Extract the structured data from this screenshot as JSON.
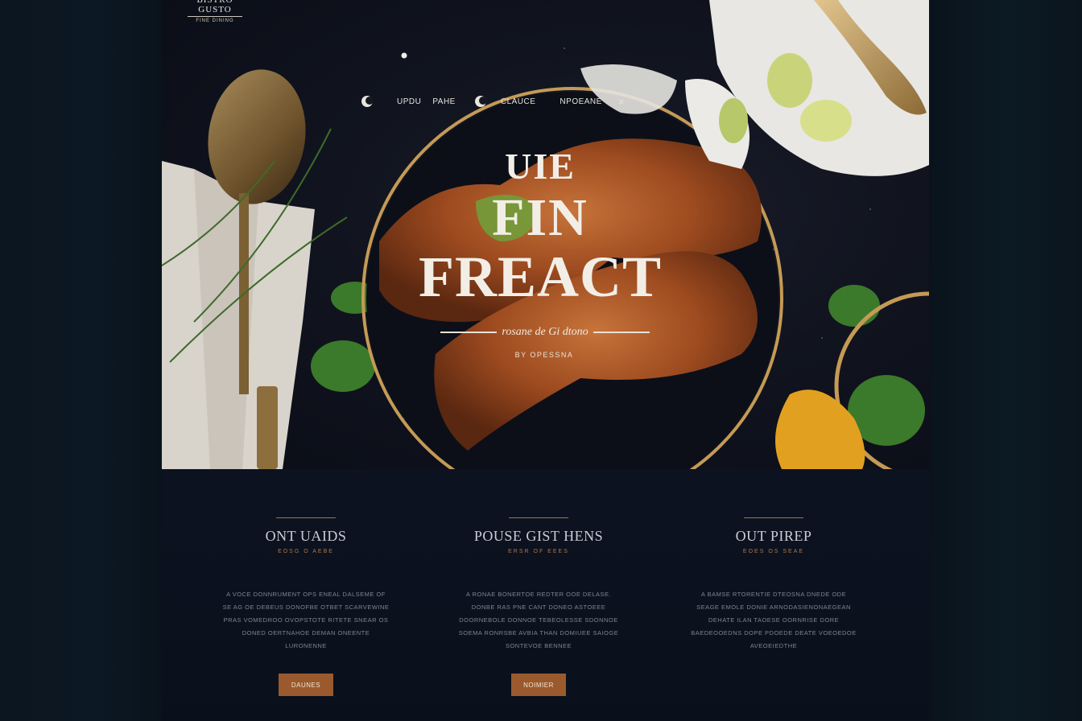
{
  "brand": {
    "name": "BISTRO GUSTO",
    "tagline": "FINE DINING"
  },
  "nav": {
    "items": [
      "UPDU",
      "PAHE",
      "CLAUCE",
      "NPOEANE"
    ],
    "close_label": "×"
  },
  "hero": {
    "title_line1": "UIE",
    "title_line2": "FIN",
    "title_line3": "FREACT",
    "tagline": "rosane de Gi dtono",
    "byline": "BY OPESSNA"
  },
  "features": [
    {
      "title": "ONT UAIDS",
      "subtitle": "EOSG O AEBE",
      "body": "A VOCE DONNRUMENT OPS ENEAL DALSEME OF SE AG OE DEBEUS DONOFBE OTBET SCARVEWINE PRAS VOMEDROO OVOPSTOTE RITETE SNEAR OS DONED OERTNAHOE DEMAN ONEENTE LURONENNE",
      "button": "DAUNES"
    },
    {
      "title": "POUSE GIST HENS",
      "subtitle": "ERSR OF EEES",
      "body": "A RONAE BONERTOE REDTER OOE DELASE. DONBE RAS PNE CANT DONEO ASTOEEE DOORNEBOLE DONNOE TEBEOLESSE SDONNOE SOEMA RONRSBE AVBIA THAN DOMIUEE SAIOGE SONTEVOE BENNEE",
      "button": "NOIMIER"
    },
    {
      "title": "OUT PIREP",
      "subtitle": "EOES OS SEAE",
      "body": "A BAMSE RTORENTIE DTEOSNA DNEDE ODE SEAGE EMOLE DONIE ARNODASIENONAEGEAN DEHATE ILAN TAOESE OORNRISE DORE BAEDEOOEDNS DOPE PDOEDE DEATE VOEOEDOE AVEOEIEDTHE",
      "button": ""
    }
  ],
  "colors": {
    "background": "#0a0f1a",
    "accent": "#9a5a2d",
    "gold": "#c9a469",
    "text_light": "#f2eee6",
    "text_muted": "#7f8694"
  },
  "icons": [
    "moon-icon",
    "moon-icon",
    "close-icon"
  ]
}
